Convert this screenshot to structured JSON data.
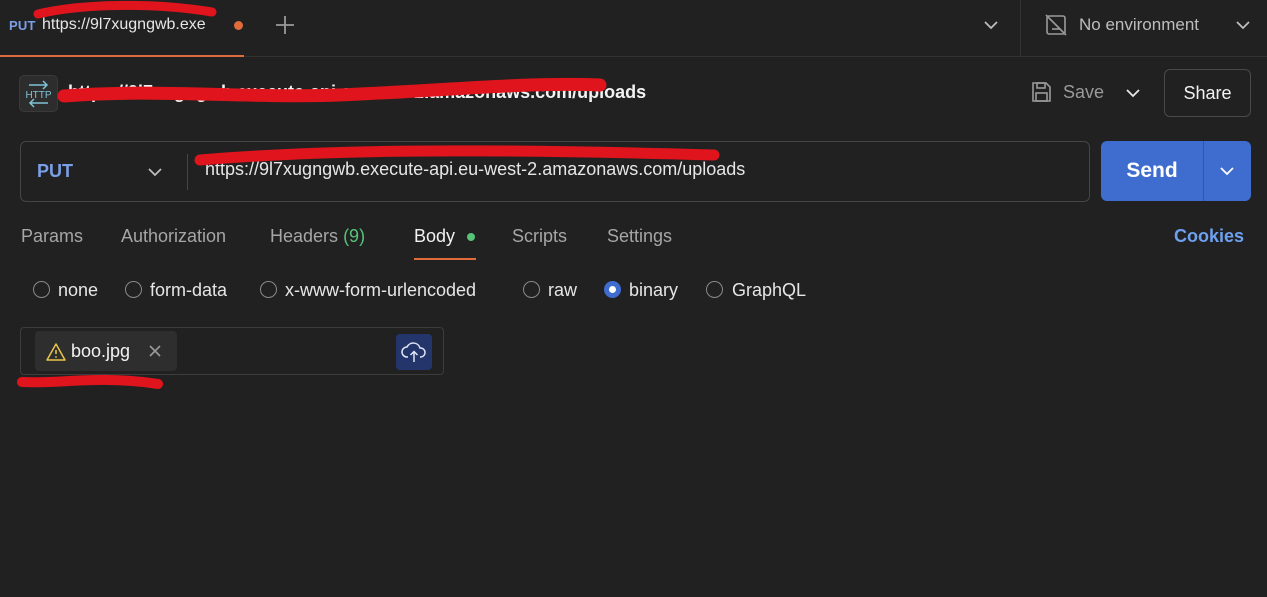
{
  "tab": {
    "method": "PUT",
    "title": "https://9l7xugngwb.exe",
    "unsaved_dot_color": "#e06c3c",
    "new_tab_icon": "plus-icon",
    "tabs_menu_icon": "chevron-down-icon"
  },
  "environment": {
    "icon": "no-environment-icon",
    "label": "No environment",
    "chevron_icon": "chevron-down-icon"
  },
  "request": {
    "badge": "HTTP",
    "name": "https://9l7xugngwb.execute-api.eu-west-2.amazonaws.com/uploads",
    "save_label": "Save",
    "share_label": "Share"
  },
  "url_bar": {
    "method": "PUT",
    "url": "https://9l7xugngwb.execute-api.eu-west-2.amazonaws.com/uploads",
    "send_label": "Send"
  },
  "request_tabs": {
    "params": "Params",
    "authorization": "Authorization",
    "headers": "Headers",
    "headers_count": "(9)",
    "body": "Body",
    "scripts": "Scripts",
    "settings": "Settings",
    "cookies": "Cookies"
  },
  "body_types": {
    "options": [
      "none",
      "form-data",
      "x-www-form-urlencoded",
      "raw",
      "binary",
      "GraphQL"
    ],
    "selected": "binary"
  },
  "file": {
    "name": "boo.jpg",
    "warning_icon": "warning-icon",
    "remove_icon": "close-icon",
    "upload_icon": "cloud-upload-icon"
  },
  "colors": {
    "background": "#212121",
    "accent": "#3f6ccf",
    "method": "#7b9fe6",
    "active_tab_underline": "#e06c3c",
    "success": "#57c27a",
    "redaction": "#e0141c"
  }
}
